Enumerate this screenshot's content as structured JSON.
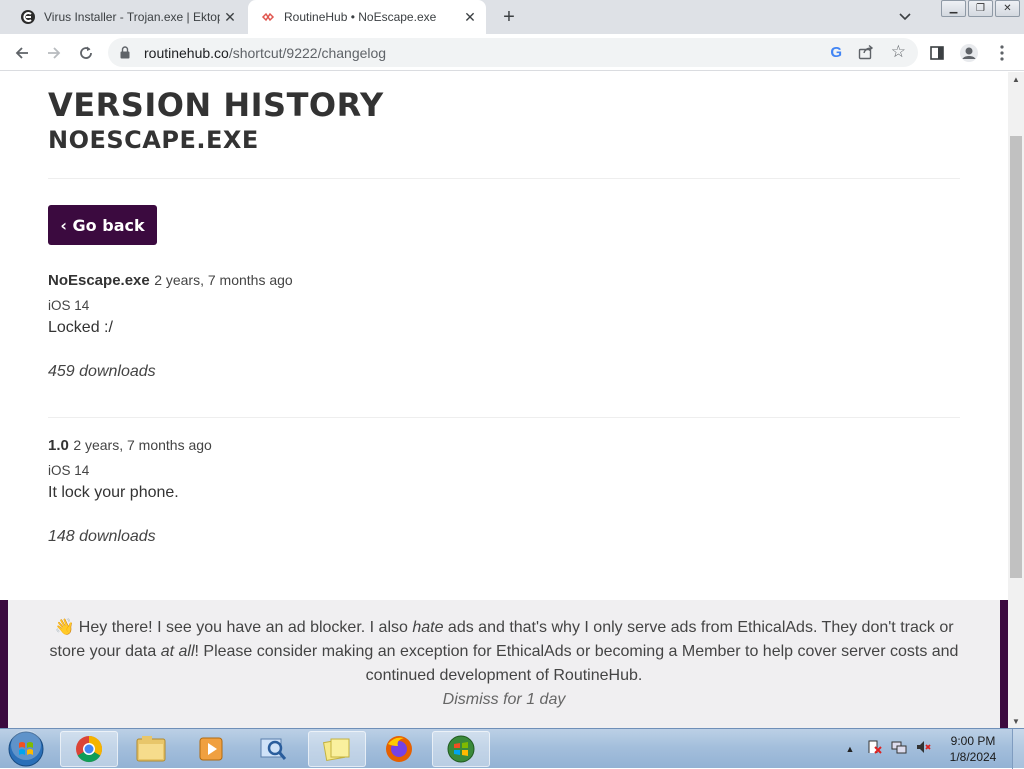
{
  "browser": {
    "tabs": [
      {
        "title": "Virus Installer - Trojan.exe | Ektop",
        "active": false,
        "favicon": "ektop-icon"
      },
      {
        "title": "RoutineHub • NoEscape.exe",
        "active": true,
        "favicon": "routinehub-icon"
      }
    ],
    "url_domain": "routinehub.co",
    "url_path": "/shortcut/9222/changelog"
  },
  "page": {
    "title": "VERSION HISTORY",
    "subtitle": "NOESCAPE.EXE",
    "go_back_label": "‹ Go back",
    "versions": [
      {
        "name": "NoEscape.exe",
        "ago": "2 years, 7 months ago",
        "os": "iOS 14",
        "description": "Locked :/",
        "downloads": "459 downloads"
      },
      {
        "name": "1.0",
        "ago": "2 years, 7 months ago",
        "os": "iOS 14",
        "description": "It lock your phone.",
        "downloads": "148 downloads"
      }
    ]
  },
  "adblock_notice": {
    "wave": "👋",
    "text_1": " Hey there! I see you have an ad blocker. I also ",
    "hate": "hate",
    "text_2": " ads and that's why I only serve ads from EthicalAds. They don't track or store your data ",
    "at_all": "at all",
    "text_3": "! Please consider making an exception for EthicalAds or becoming a Member to help cover server costs and continued development of RoutineHub.",
    "dismiss": "Dismiss for 1 day"
  },
  "taskbar": {
    "time": "9:00 PM",
    "date": "1/8/2024",
    "apps": [
      "chrome-icon",
      "explorer-icon",
      "media-player-icon",
      "search-tool-icon",
      "sticky-notes-icon",
      "firefox-icon",
      "windows-security-icon"
    ]
  },
  "colors": {
    "brand": "#3b0a3f",
    "tab_bar": "#dee1e6"
  }
}
